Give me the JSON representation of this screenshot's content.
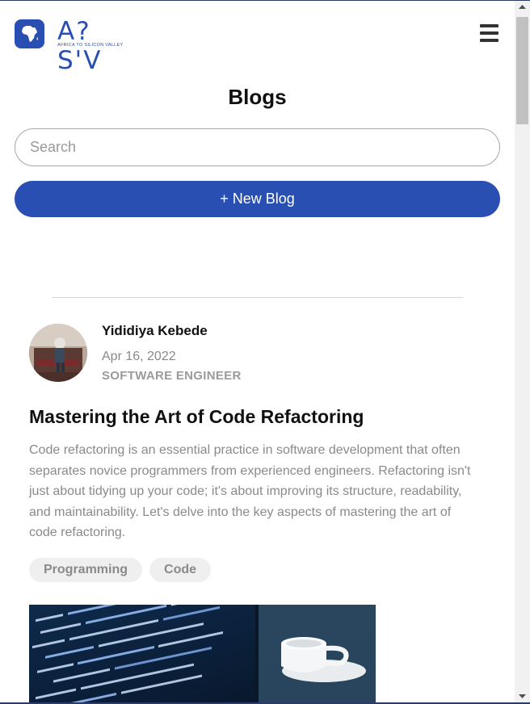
{
  "header": {
    "logo_text": "A?S'V",
    "logo_tagline": "AFRICA TO SILICON VALLEY",
    "menu_icon": "hamburger-icon"
  },
  "page": {
    "title": "Blogs"
  },
  "search": {
    "placeholder": "Search",
    "value": ""
  },
  "actions": {
    "new_blog_label": "+ New Blog"
  },
  "post": {
    "author_name": "Yididiya Kebede",
    "date": "Apr 16, 2022",
    "author_role": "SOFTWARE ENGINEER",
    "title": "Mastering the Art of Code Refactoring",
    "excerpt": "Code refactoring is an essential practice in software development that often separates novice programmers from experienced engineers. Refactoring isn't just about tidying up your code; it's about improving its structure, readability, and maintainability. Let's delve into the key aspects of mastering the art of code refactoring.",
    "tags": [
      "Programming",
      "Code"
    ]
  },
  "colors": {
    "brand": "#2a4fb2",
    "muted_text": "#8a8a8a",
    "tag_bg": "#efefef"
  }
}
